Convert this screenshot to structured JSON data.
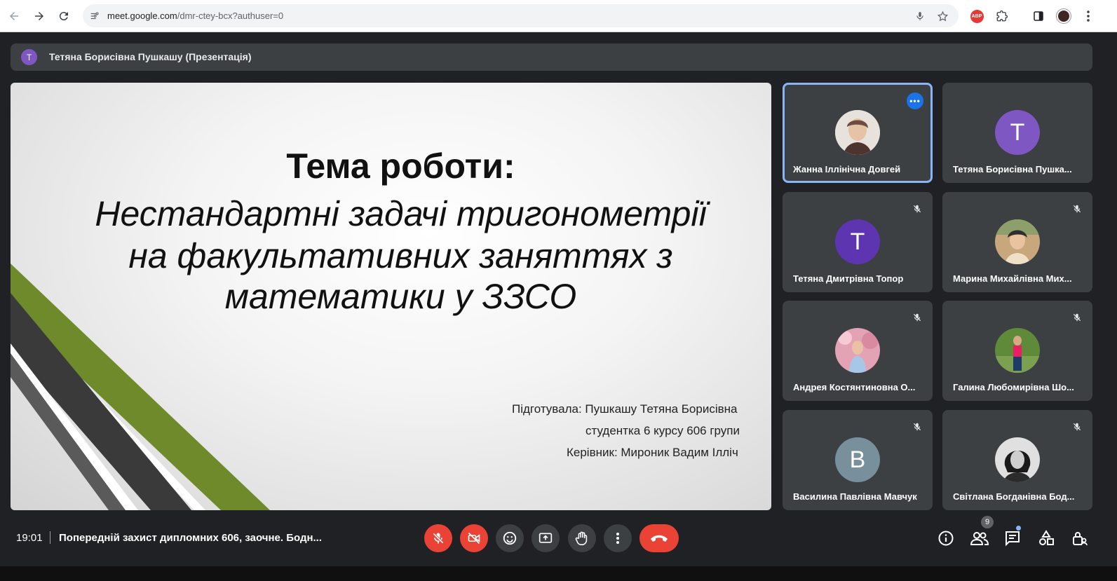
{
  "browser": {
    "url_host": "meet.google.com",
    "url_path": "/dmr-ctey-bcx?authuser=0",
    "extension_abp": "ABP"
  },
  "presenter": {
    "initial": "T",
    "label": "Тетяна Борисівна Пушкашу (Презентація)"
  },
  "slide": {
    "title": "Тема роботи:",
    "subtitle_lines": [
      "Нестандартні задачі тригонометрії",
      "на факультативних заняттях з",
      "математики у ЗЗСО"
    ],
    "credits": [
      "Підготувала:  Пушкашу Тетяна Борисівна",
      "студентка 6 курсу 606 групи",
      "Керівник: Мироник Вадим Ілліч"
    ],
    "colors": {
      "green": "#6e8a2a",
      "dark": "#3a3a3a"
    }
  },
  "participants": [
    {
      "name": "Жанна Іллінічна Довгей",
      "type": "photo",
      "active": true,
      "muted": false
    },
    {
      "name": "Тетяна Борисівна Пушкашу",
      "display": "Тетяна Борисівна Пушка...",
      "initial": "T",
      "color": "#7e57c2",
      "muted": false
    },
    {
      "name": "Тетяна Дмитрівна Топор",
      "initial": "T",
      "color": "#5e35b1",
      "muted": true
    },
    {
      "name": "Марина Михайлівна Мих...",
      "type": "photo",
      "muted": true
    },
    {
      "name": "Андрея Костянтиновна О...",
      "type": "photo",
      "muted": true
    },
    {
      "name": "Галина Любомирівна Шо...",
      "type": "photo",
      "muted": true
    },
    {
      "name": "Василина Павлівна Мавчук",
      "initial": "B",
      "color": "#78909c",
      "muted": true
    },
    {
      "name": "Світлана Богданівна Бод...",
      "type": "photo",
      "muted": true
    }
  ],
  "meeting": {
    "time": "19:01",
    "title": "Попередній захист дипломних 606, заочне. Бодн...",
    "people_count": "9"
  },
  "controls": {
    "mic": "mic-off",
    "camera": "camera-off",
    "reactions": "emoji",
    "present": "present-screen",
    "raise_hand": "hand",
    "more": "more-vert",
    "leave": "call-end"
  }
}
